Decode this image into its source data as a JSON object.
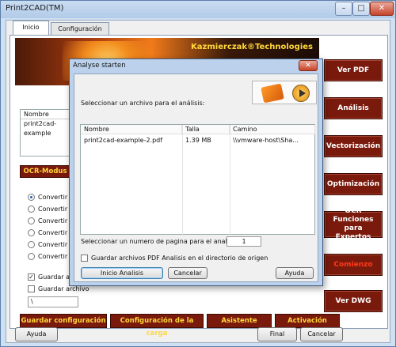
{
  "window": {
    "title": "Print2CAD(TM)"
  },
  "tabs": [
    {
      "label": "Inicio"
    },
    {
      "label": "Configuración"
    }
  ],
  "banner": {
    "brand": "Kazmierczak®Technologies"
  },
  "left_list": {
    "header": "Nombre",
    "rows": [
      "print2cad-example"
    ]
  },
  "ocr_button": "OCR-Modus",
  "radios": [
    {
      "label": "Convertir PDF",
      "checked": true
    },
    {
      "label": "Convertir HPG",
      "checked": false
    },
    {
      "label": "Convertir DWF",
      "checked": false
    },
    {
      "label": "Convertir TIFF",
      "checked": false
    },
    {
      "label": "Convertir PDF",
      "checked": false
    },
    {
      "label": "Convertir DWG",
      "checked": false
    }
  ],
  "checkboxes": [
    {
      "label": "Guardar archivo",
      "checked": true
    },
    {
      "label": "Guardar archivo",
      "checked": false
    }
  ],
  "path_field": "\\",
  "right_buttons": [
    "Ver PDF",
    "Análisis",
    "Vectorización",
    "Optimización",
    "OCR Funciones para Expertos",
    "Comienzo",
    "Ver DWG"
  ],
  "bottom_buttons": [
    "Guardar configuración",
    "Configuración de la carga",
    "Asistente",
    "Activación"
  ],
  "footer": {
    "help": "Ayuda",
    "final": "Final",
    "cancel": "Cancelar"
  },
  "dialog": {
    "title": "Analyse starten",
    "select_file_label": "Seleccionar un archivo para el análisis:",
    "columns": [
      "Nombre",
      "Talla",
      "Camino"
    ],
    "rows": [
      {
        "name": "print2cad-example-2.pdf",
        "size": "1.39 MB",
        "path": "\\\\vmware-host\\Sha..."
      }
    ],
    "page_label": "Seleccionar un numero de pagina para el analisis:",
    "page_number": "1",
    "save_checkbox": "Guardar archivos PDF Analisis en el directorio de origen",
    "start_button": "Inicio Analisis",
    "cancel_button": "Cancelar",
    "help_button": "Ayuda"
  }
}
